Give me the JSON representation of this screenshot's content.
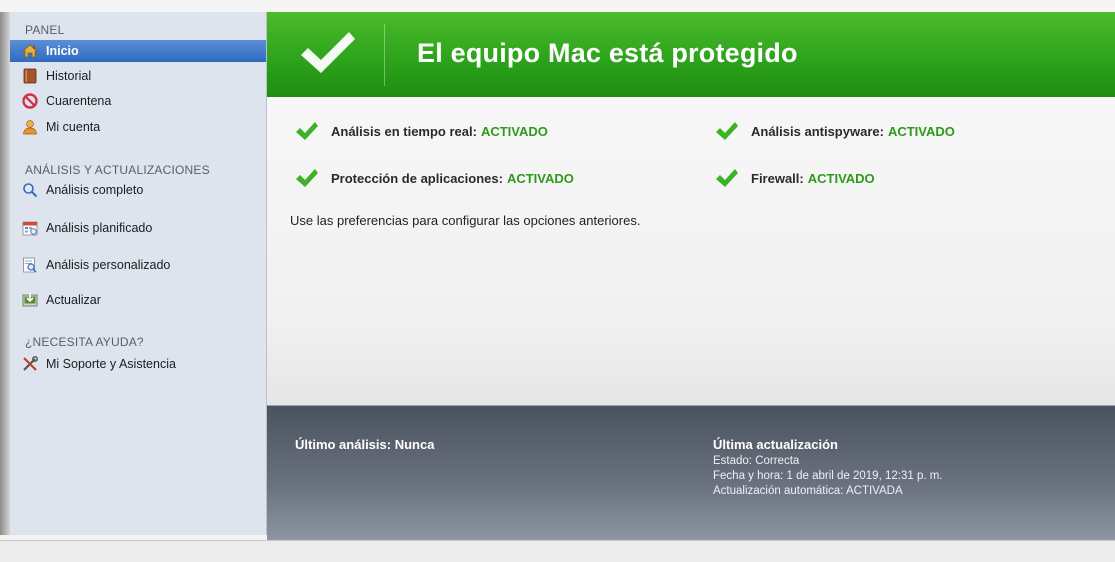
{
  "sidebar": {
    "panel_title": "PANEL",
    "items": [
      {
        "label": "Inicio",
        "icon": "home-icon"
      },
      {
        "label": "Historial",
        "icon": "book-icon"
      },
      {
        "label": "Cuarentena",
        "icon": "no-entry-icon"
      },
      {
        "label": "Mi cuenta",
        "icon": "user-icon"
      }
    ],
    "scans_title": "ANÁLISIS Y ACTUALIZACIONES",
    "scan_items": [
      {
        "label": "Análisis completo",
        "icon": "magnifier-icon"
      },
      {
        "label": "Análisis planificado",
        "icon": "calendar-icon"
      },
      {
        "label": "Análisis personalizado",
        "icon": "custom-scan-icon"
      },
      {
        "label": "Actualizar",
        "icon": "update-icon"
      }
    ],
    "help_title": "¿NECESITA AYUDA?",
    "help_items": [
      {
        "label": "Mi Soporte y Asistencia",
        "icon": "tools-icon"
      }
    ]
  },
  "header": {
    "title": "El equipo Mac está protegido",
    "icon": "checkmark-icon"
  },
  "status": [
    {
      "label": "Análisis en tiempo real:",
      "value": "ACTIVADO"
    },
    {
      "label": "Análisis antispyware:",
      "value": "ACTIVADO"
    },
    {
      "label": "Protección de aplicaciones:",
      "value": "ACTIVADO"
    },
    {
      "label": "Firewall:",
      "value": "ACTIVADO"
    }
  ],
  "hint": "Use las preferencias para configurar las opciones anteriores.",
  "last_scan": "Último análisis: Nunca",
  "last_update": {
    "title": "Última actualización",
    "lines": [
      "Estado: Correcta",
      "Fecha y hora: 1 de abril de 2019, 12:31 p. m.",
      "Actualización automática: ACTIVADA"
    ]
  },
  "colors": {
    "header_green": "#2da41c",
    "status_green": "#2e9a1b",
    "sidebar_bg": "#dde4ee",
    "active_blue": "#3a73c6",
    "bottom_panel": "#5d6573"
  }
}
